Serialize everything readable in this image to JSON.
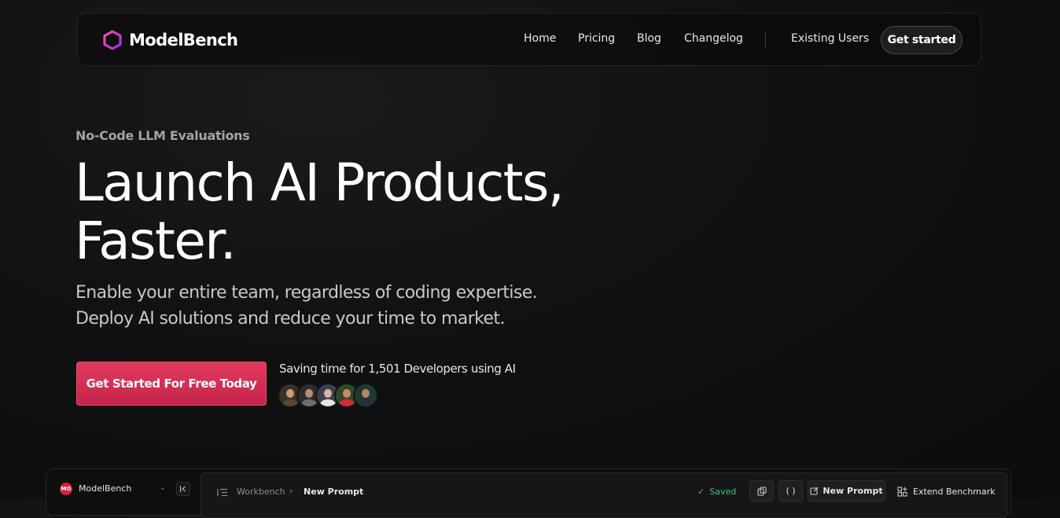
{
  "nav": {
    "brand": "ModelBench",
    "brand_color": "#e0349a",
    "links": [
      "Home",
      "Pricing",
      "Blog",
      "Changelog",
      "Existing Users"
    ],
    "cta": "Get started"
  },
  "hero": {
    "eyebrow": "No-Code LLM Evaluations",
    "title_line1": "Launch AI Products,",
    "title_line2": "Faster.",
    "subtitle_line1": "Enable your entire team, regardless of coding expertise.",
    "subtitle_line2": "Deploy AI solutions and reduce your time to market.",
    "cta": "Get Started For Free Today",
    "accent_color": "#d72d55",
    "social_proof": "Saving time for 1,501 Developers using AI",
    "avatar_count": 5
  },
  "app_preview": {
    "workspace_initials": "MO",
    "workspace_name": "ModelBench",
    "breadcrumb_root": "Workbench",
    "breadcrumb_current": "New Prompt",
    "status": "Saved",
    "status_color": "#3ec46d",
    "code_button": "( )",
    "new_prompt_button": "New Prompt",
    "extend_button": "Extend Benchmark"
  }
}
